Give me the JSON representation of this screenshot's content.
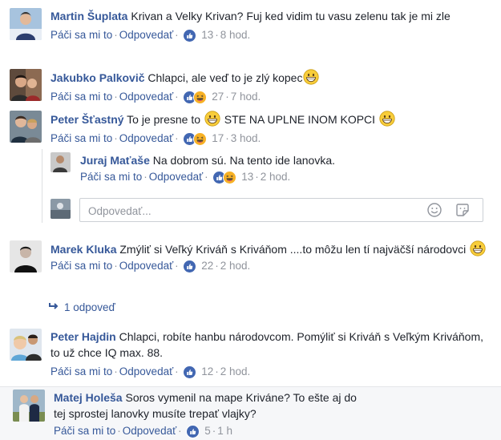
{
  "colors": {
    "link": "#365899",
    "meta": "#90949c",
    "like": "#4267b2",
    "haha": "#f7b125"
  },
  "comments": [
    {
      "author": "Martin Šuplata",
      "text": "Krivan a Velky Krivan? Fuj ked vidim tu vasu zelenu tak je mi zle",
      "like": "Páči sa mi to",
      "reply": "Odpovedať",
      "reactions": [
        "like-icon"
      ],
      "count": "13",
      "time": "8 hod."
    },
    {
      "author": "Jakubko Palkovič",
      "text": "Chlapci, ale veď to je zlý kopec",
      "like": "Páči sa mi to",
      "reply": "Odpovedať",
      "reactions": [
        "like-icon",
        "haha-icon"
      ],
      "count": "27",
      "time": "7 hod."
    },
    {
      "author": "Peter Šťastný",
      "text_a": "To je presne to",
      "text_b": "STE NA UPLNE INOM KOPCI",
      "like": "Páči sa mi to",
      "reply": "Odpovedať",
      "reactions": [
        "like-icon",
        "haha-icon"
      ],
      "count": "17",
      "time": "3 hod."
    },
    {
      "author": "Juraj Maťaše",
      "text": "Na dobrom sú. Na tento ide lanovka.",
      "like": "Páči sa mi to",
      "reply": "Odpovedať",
      "reactions": [
        "like-icon",
        "haha-icon"
      ],
      "count": "13",
      "time": "2 hod."
    },
    {
      "author": "Marek Kluka",
      "text": "Zmýliť si Veľký Kriváň s Kriváňom ....to môžu len tí najväčší národovci",
      "like": "Páči sa mi to",
      "reply": "Odpovedať",
      "reactions": [
        "like-icon"
      ],
      "count": "22",
      "time": "2 hod."
    },
    {
      "author": "Peter Hajdin",
      "text": "Chlapci, robíte hanbu národovcom. Pomýliť si Kriváň s Veľkým Kriváňom, to už chce IQ max. 88.",
      "like": "Páči sa mi to",
      "reply": "Odpovedať",
      "reactions": [
        "like-icon"
      ],
      "count": "12",
      "time": "2 hod."
    },
    {
      "author": "Matej Holeša",
      "text": "Soros vymenil na mape Kriváne? To ešte aj do tej sprostej lanovky musíte trepať vlajky?",
      "like": "Páči sa mi to",
      "reply": "Odpovedať",
      "reactions": [
        "like-icon"
      ],
      "count": "5",
      "time": "1 h"
    }
  ],
  "reply_box": {
    "placeholder": "Odpovedať..."
  },
  "more_replies": "1 odpoveď"
}
